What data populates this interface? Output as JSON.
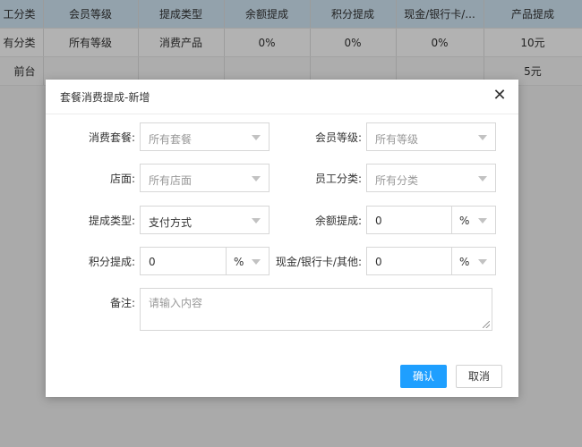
{
  "background_table": {
    "headers": [
      "工分类",
      "会员等级",
      "提成类型",
      "余额提成",
      "积分提成",
      "现金/银行卡/...",
      "产品提成"
    ],
    "rows": [
      [
        "有分类",
        "所有等级",
        "消费产品",
        "0%",
        "0%",
        "0%",
        "10元"
      ],
      [
        "前台",
        "",
        "",
        "",
        "",
        "",
        "5元"
      ]
    ],
    "header_color": "#d3e8f7"
  },
  "modal": {
    "title": "套餐消费提成-新增",
    "close_icon": "close-icon",
    "fields": {
      "package": {
        "label": "消费套餐:",
        "value": "所有套餐"
      },
      "member_level": {
        "label": "会员等级:",
        "value": "所有等级"
      },
      "store": {
        "label": "店面:",
        "value": "所有店面"
      },
      "staff_category": {
        "label": "员工分类:",
        "value": "所有分类"
      },
      "commission_type": {
        "label": "提成类型:",
        "value": "支付方式"
      },
      "balance_commission": {
        "label": "余额提成:",
        "value": "0",
        "unit": "%"
      },
      "points_commission": {
        "label": "积分提成:",
        "value": "0",
        "unit": "%"
      },
      "cash_commission": {
        "label": "现金/银行卡/其他:",
        "value": "0",
        "unit": "%"
      },
      "remark": {
        "label": "备注:",
        "placeholder": "请输入内容"
      }
    },
    "confirm_label": "确认",
    "cancel_label": "取消",
    "accent_color": "#1e9fff"
  }
}
